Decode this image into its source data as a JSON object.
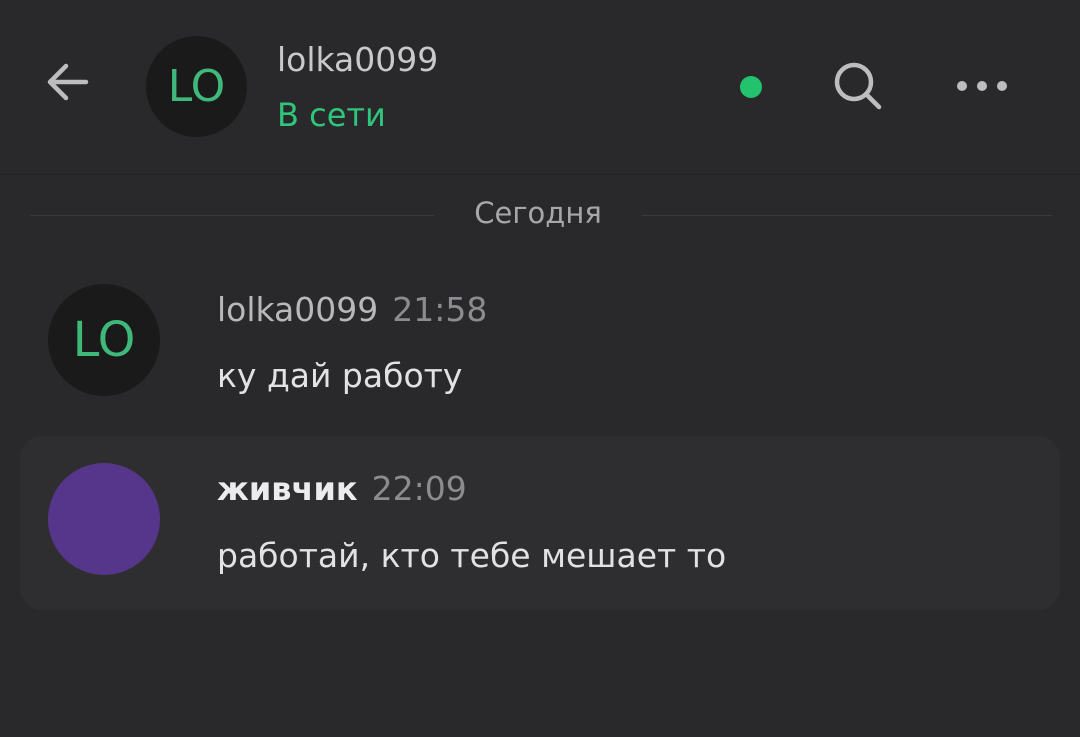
{
  "header": {
    "avatar_initials": "LO",
    "username": "lolka0099",
    "status": "В сети",
    "back_icon": "arrow-left-icon",
    "search_icon": "search-icon",
    "more_icon": "more-dots-icon",
    "online_indicator_color": "#22c36c",
    "status_color": "#2fc57a"
  },
  "date_separator": {
    "label": "Сегодня"
  },
  "messages": [
    {
      "avatar_initials": "LO",
      "author": "lolka0099",
      "time": "21:58",
      "text": "ку дай работу"
    },
    {
      "avatar_color": "#56368a",
      "author": "живчик",
      "time": "22:09",
      "text": "работай, кто тебе мешает то"
    }
  ]
}
